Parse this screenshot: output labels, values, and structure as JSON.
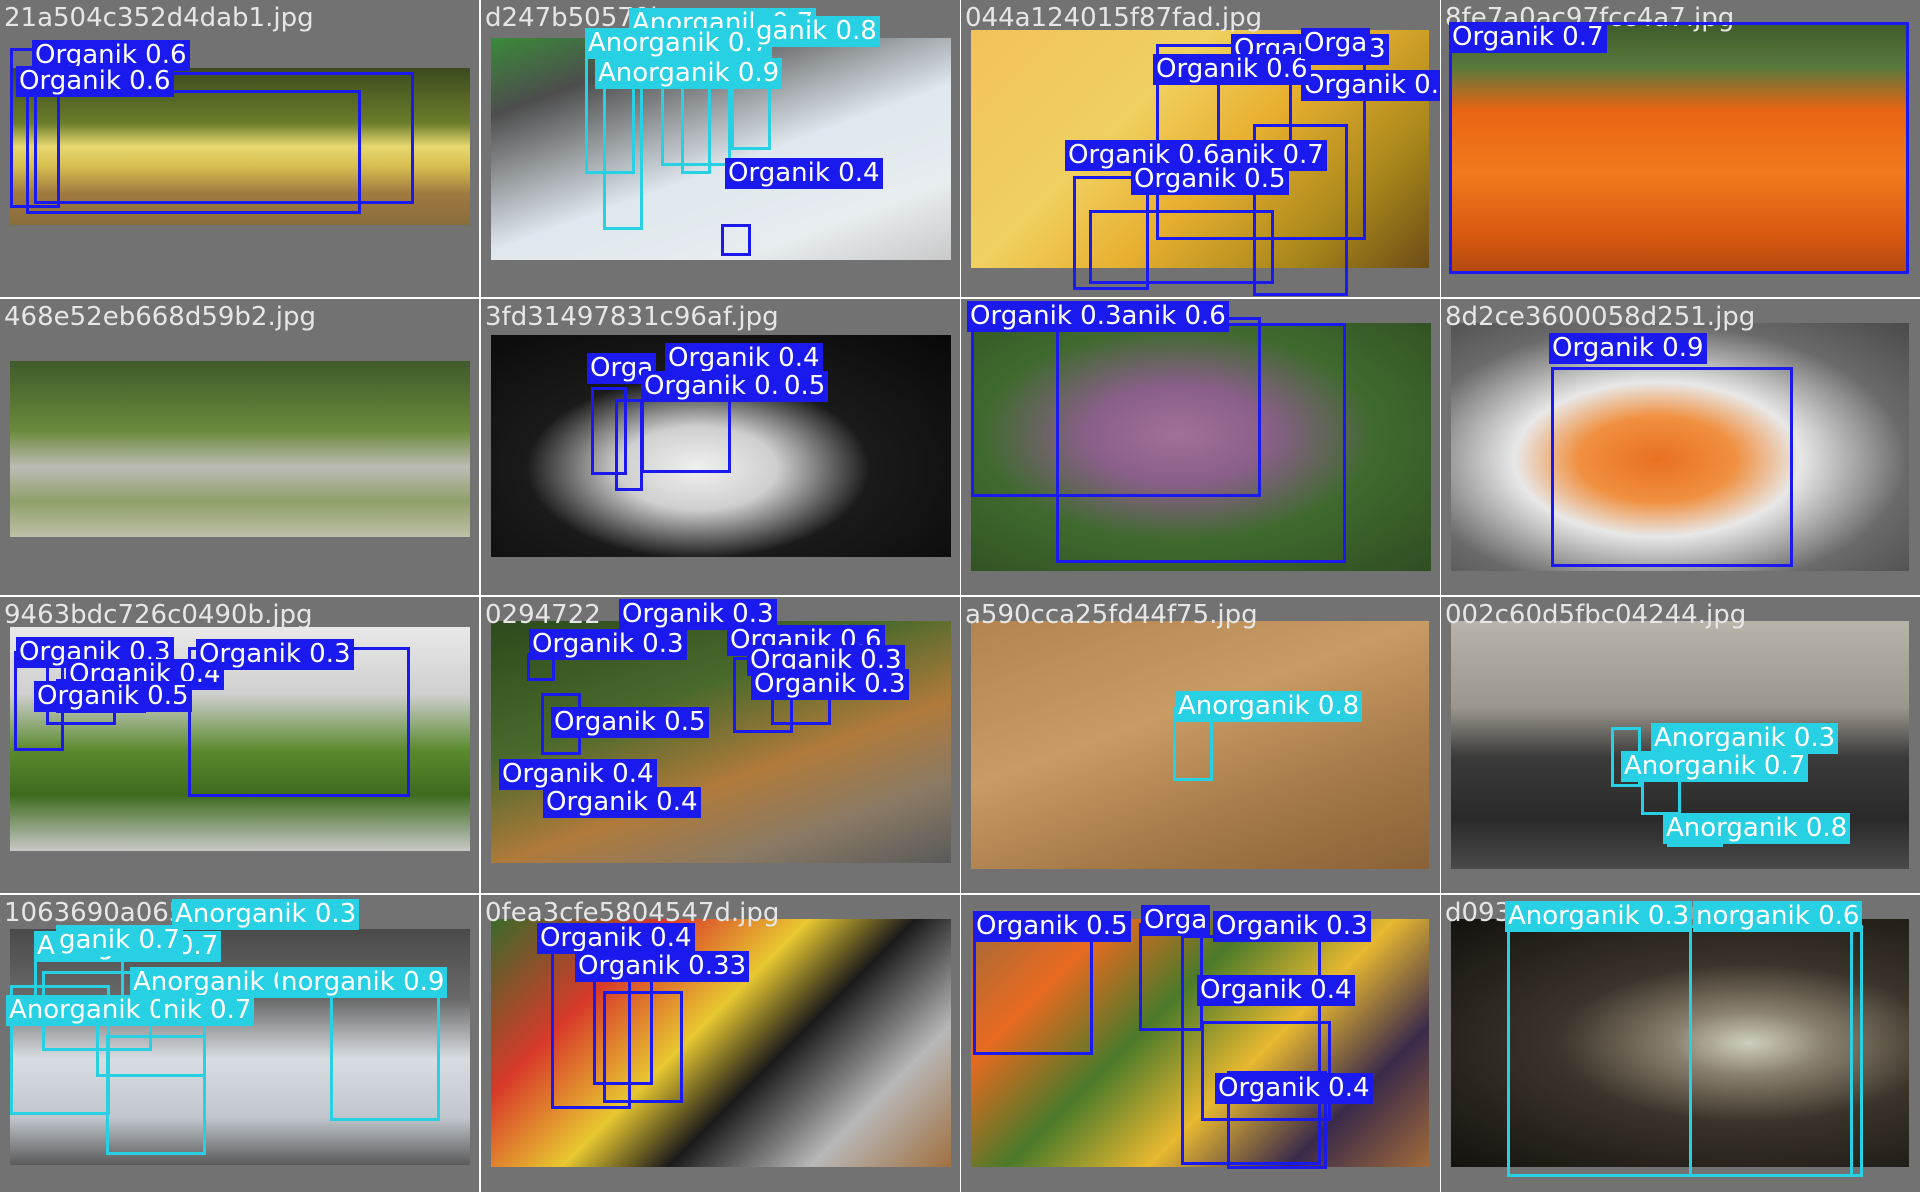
{
  "title": "Detection predictions mosaic",
  "colors": {
    "organik": "#1a1aee",
    "anorganik": "#27d0e2",
    "tile_bg": "#727272"
  },
  "tiles": [
    {
      "filename": "21a504c352d4dab1.jpg",
      "labels": [
        {
          "text": "Organik 0.6",
          "class": "org"
        },
        {
          "text": "Organik 0.6",
          "class": "org"
        }
      ]
    },
    {
      "filename": "d247b50570b",
      "labels": [
        {
          "text": "Anorganik 0.7",
          "class": "ano"
        },
        {
          "text": "Anorganik 0.7",
          "class": "ano"
        },
        {
          "text": "ganik 0.8",
          "class": "ano"
        },
        {
          "text": "Anorganik 0.9",
          "class": "ano"
        },
        {
          "text": "Organik 0.4",
          "class": "org"
        }
      ]
    },
    {
      "filename": "044a124015f87fad.jpg",
      "labels": [
        {
          "text": "Organik 0.3",
          "class": "org"
        },
        {
          "text": "Organik 0.3",
          "class": "org"
        },
        {
          "text": "Organik 0.6",
          "class": "org"
        },
        {
          "text": "Organik 0.6anik 0.7",
          "class": "org"
        },
        {
          "text": "Organik 0.5",
          "class": "org"
        },
        {
          "text": "Orga",
          "class": "org"
        }
      ]
    },
    {
      "filename": "8fe7a0ac97fcc4a7.jpg",
      "labels": [
        {
          "text": "Organik 0.7",
          "class": "org"
        }
      ]
    },
    {
      "filename": "468e52eb668d59b2.jpg",
      "labels": []
    },
    {
      "filename": "3fd31497831c96af.jpg",
      "labels": [
        {
          "text": "Organik 0.4",
          "class": "org"
        },
        {
          "text": "Orga",
          "class": "org"
        },
        {
          "text": "Organik 0.3",
          "class": "org"
        },
        {
          "text": "0.5",
          "class": "org"
        }
      ]
    },
    {
      "filename": "",
      "labels": [
        {
          "text": "Organik 0.3anik 0.6",
          "class": "org"
        }
      ]
    },
    {
      "filename": "8d2ce3600058d251.jpg",
      "labels": [
        {
          "text": "Organik 0.9",
          "class": "org"
        }
      ]
    },
    {
      "filename": "9463bdc726c0490b.jpg",
      "labels": [
        {
          "text": "Organik 0.3",
          "class": "org"
        },
        {
          "text": "Organik 0.4",
          "class": "org"
        },
        {
          "text": "Organik 0.5",
          "class": "org"
        },
        {
          "text": "Organik 0.3",
          "class": "org"
        }
      ]
    },
    {
      "filename": "0294722",
      "labels": [
        {
          "text": "Organik 0.3",
          "class": "org"
        },
        {
          "text": "Organik 0.3",
          "class": "org"
        },
        {
          "text": "Organik 0.5",
          "class": "org"
        },
        {
          "text": "Organik 0.4",
          "class": "org"
        },
        {
          "text": "Organik 0.4",
          "class": "org"
        },
        {
          "text": "Organik 0.6",
          "class": "org"
        },
        {
          "text": "Organik 0.3",
          "class": "org"
        },
        {
          "text": "Organik 0.3",
          "class": "org"
        }
      ]
    },
    {
      "filename": "a590cca25fd44f75.jpg",
      "labels": [
        {
          "text": "Anorganik 0.8",
          "class": "ano"
        }
      ]
    },
    {
      "filename": "002c60d5fbc04244.jpg",
      "labels": [
        {
          "text": "Anorganik 0.3",
          "class": "ano"
        },
        {
          "text": "Anorganik 0.7",
          "class": "ano"
        },
        {
          "text": "Anorganik 0.8",
          "class": "ano"
        }
      ]
    },
    {
      "filename": "1063690a0658",
      "labels": [
        {
          "text": "Anorganik 0.3",
          "class": "ano"
        },
        {
          "text": "Anorganik 0.7",
          "class": "ano"
        },
        {
          "text": "ganik 0.7",
          "class": "ano"
        },
        {
          "text": "Anorganik 0.3",
          "class": "ano"
        },
        {
          "text": "norganik 0.9",
          "class": "ano"
        },
        {
          "text": "Anorganik 0.6",
          "class": "ano"
        },
        {
          "text": "nik 0.7",
          "class": "ano"
        }
      ]
    },
    {
      "filename": "0fea3cfe5804547d.jpg",
      "labels": [
        {
          "text": "Organik 0.4",
          "class": "org"
        },
        {
          "text": "Organik 0.33",
          "class": "org"
        }
      ]
    },
    {
      "filename": "",
      "labels": [
        {
          "text": "Organik 0.5",
          "class": "org"
        },
        {
          "text": "Organik 0.3",
          "class": "org"
        },
        {
          "text": "Orga",
          "class": "org"
        },
        {
          "text": "Organik 0.4",
          "class": "org"
        },
        {
          "text": "Organik 0.4",
          "class": "org"
        }
      ]
    },
    {
      "filename": "d0930f4aca4dfdd.jpg",
      "labels": [
        {
          "text": "Anorganik 0.3",
          "class": "ano"
        },
        {
          "text": "norganik 0.6",
          "class": "ano"
        }
      ]
    }
  ]
}
